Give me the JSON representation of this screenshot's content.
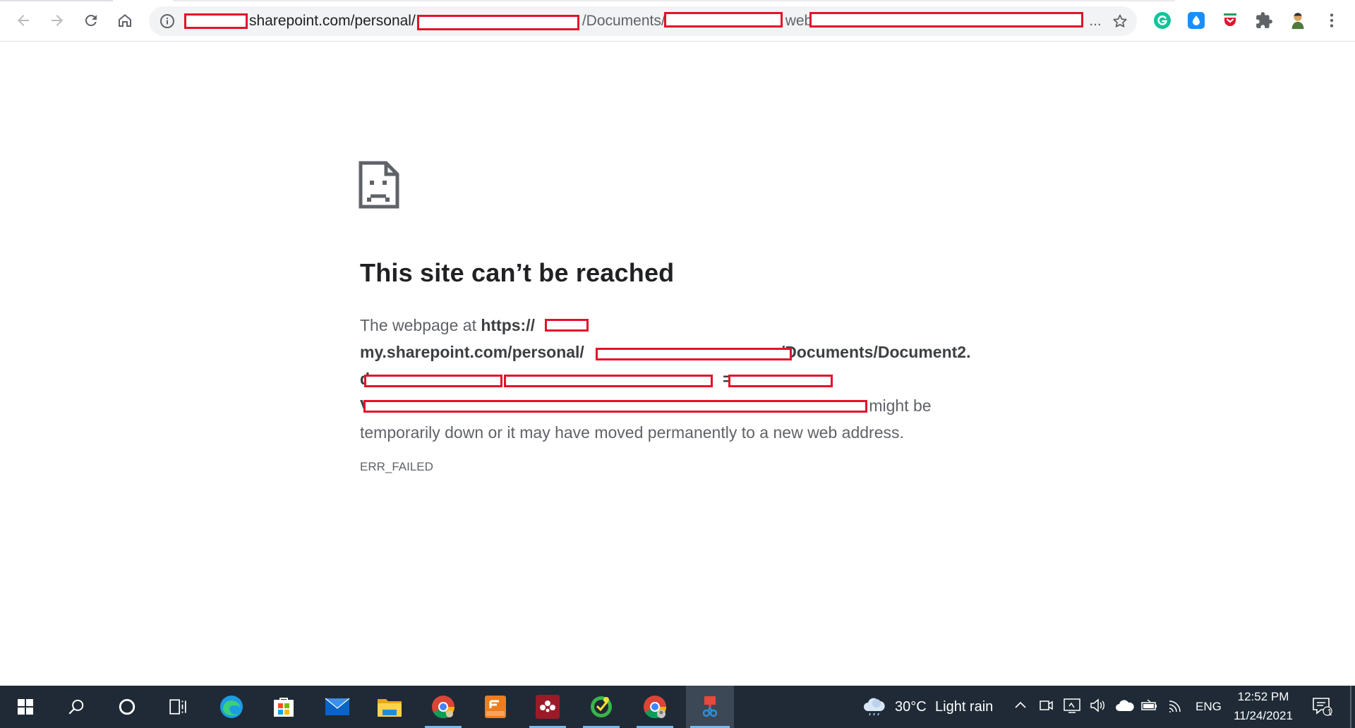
{
  "browser": {
    "url_host_part": "sharepoint.com/personal/",
    "url_path_part_1": "/Documents/",
    "url_path_part_2": "web",
    "url_ellipsis": "..."
  },
  "error_page": {
    "title": "This site can’t be reached",
    "body_prefix": "The webpage at ",
    "url_line_1": "https://",
    "url_line_1_suffix": "-",
    "url_line_2_prefix": "my.sharepoint.com/personal/",
    "url_line_2_suffix": "/Documents/Document2.",
    "url_line_3_start": "d",
    "url_line_3_equals": "=",
    "url_line_4_start": "V",
    "body_line_4_suffix": "might be",
    "body_line_5": "temporarily down or it may have moved permanently to a new web address.",
    "error_code": "ERR_FAILED"
  },
  "taskbar": {
    "apps": [
      {
        "name": "edge"
      },
      {
        "name": "store"
      },
      {
        "name": "mail"
      },
      {
        "name": "file-explorer"
      },
      {
        "name": "chrome"
      },
      {
        "name": "foxit-pdf"
      },
      {
        "name": "mendeley"
      },
      {
        "name": "corel"
      },
      {
        "name": "chrome-alt"
      },
      {
        "name": "snipping-tool"
      }
    ],
    "weather_temp": "30°C",
    "weather_desc": "Light rain",
    "language": "ENG",
    "time": "12:52 PM",
    "date": "11/24/2021",
    "notification_count": "1"
  },
  "colors": {
    "redaction": "#e3122b",
    "taskbar_bg": "#1f2a36",
    "title_text": "#202124",
    "body_text": "#5f6368"
  }
}
